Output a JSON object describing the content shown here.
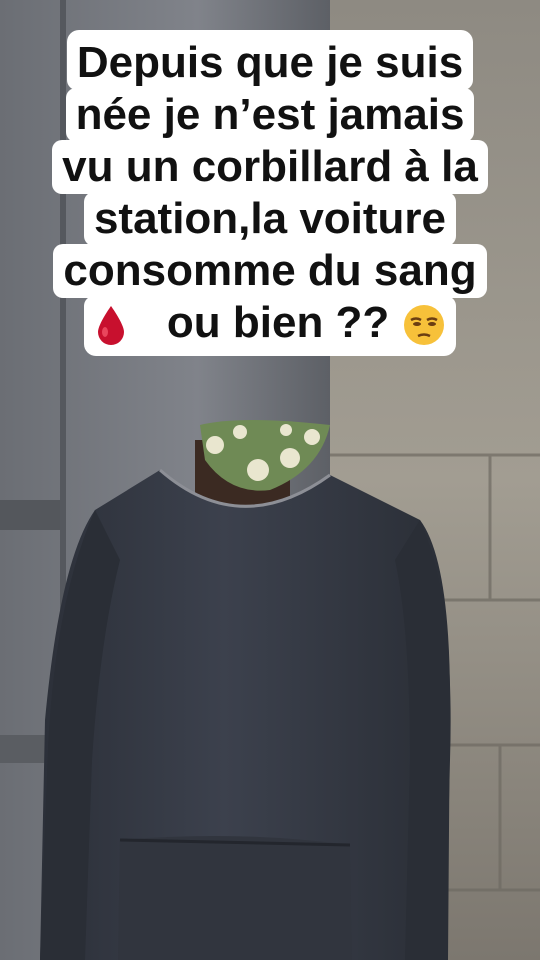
{
  "caption": {
    "lines": [
      "Depuis que je suis",
      "née je n’est jamais",
      "vu un corbillard à la",
      "station,la voiture",
      "consomme du sang",
      "ou bien ??"
    ]
  },
  "icons": {
    "blood_drop": "drop-of-blood-emoji",
    "unamused_face": "unamused-face-emoji"
  },
  "colors": {
    "caption_bg": "#ffffff",
    "caption_text": "#111111",
    "blood": "#c8102e",
    "emoji_face": "#f7c13a",
    "sweater": "#3a3f4b",
    "wall": "#9a9589",
    "door": "#6f7278"
  }
}
